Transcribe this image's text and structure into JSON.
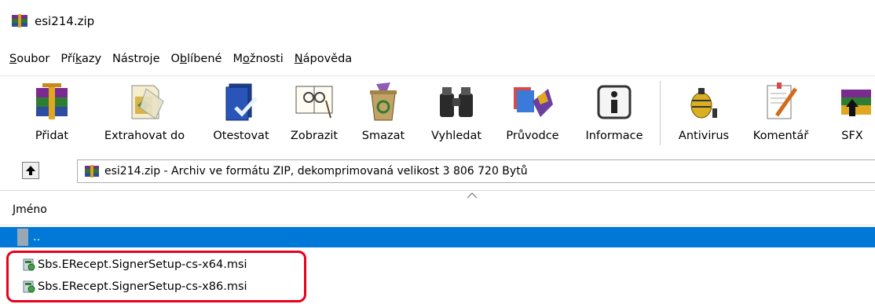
{
  "window": {
    "title": "esi214.zip"
  },
  "menu": [
    {
      "label": "Soubor",
      "u": "S",
      "rest": "oubor"
    },
    {
      "label": "Příkazy",
      "pre": "Pří",
      "u": "k",
      "rest": "azy"
    },
    {
      "label": "Nástroje",
      "pre": "Nástro",
      "u": "j",
      "rest": "e"
    },
    {
      "label": "Oblíbené",
      "pre": "O",
      "u": "b",
      "rest": "líbené"
    },
    {
      "label": "Možnosti",
      "pre": "M",
      "u": "o",
      "rest": "žnosti"
    },
    {
      "label": "Nápověda",
      "u": "N",
      "rest": "ápověda"
    }
  ],
  "toolbar": {
    "add": "Přidat",
    "extract": "Extrahovat do",
    "test": "Otestovat",
    "view": "Zobrazit",
    "delete": "Smazat",
    "find": "Vyhledat",
    "wizard": "Průvodce",
    "info": "Informace",
    "antivirus": "Antivirus",
    "comment": "Komentář",
    "sfx": "SFX"
  },
  "address": {
    "text": "esi214.zip - Archiv ve formátu ZIP, dekomprimovaná velikost 3 806 720 Bytů"
  },
  "list": {
    "column_name": "Jméno",
    "rows": [
      {
        "name": "..",
        "selected": true
      },
      {
        "name": "Sbs.ERecept.SignerSetup-cs-x64.msi",
        "selected": false
      },
      {
        "name": "Sbs.ERecept.SignerSetup-cs-x86.msi",
        "selected": false
      }
    ]
  },
  "colors": {
    "selection": "#0078d7",
    "highlight": "#e8001c"
  }
}
